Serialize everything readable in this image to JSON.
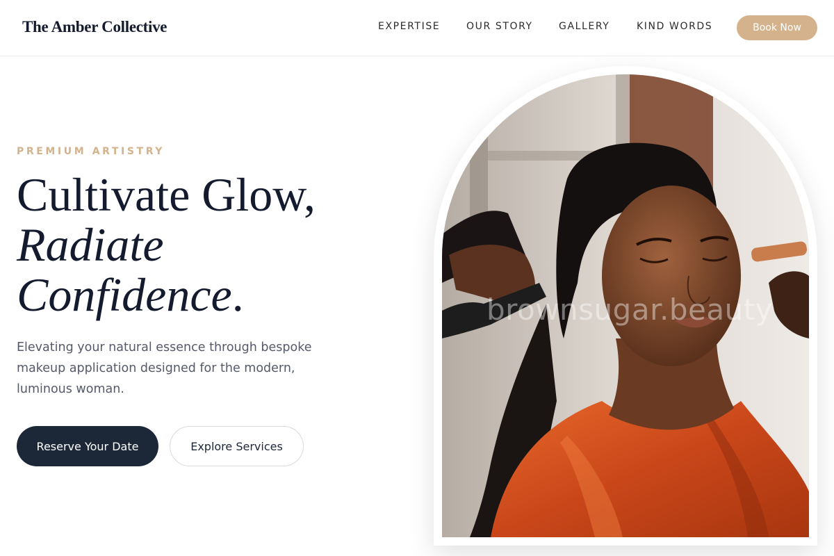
{
  "header": {
    "brand": "The Amber Collective",
    "nav": [
      "EXPERTISE",
      "OUR STORY",
      "GALLERY",
      "KIND WORDS"
    ],
    "cta": "Book Now"
  },
  "hero": {
    "eyebrow": "PREMIUM ARTISTRY",
    "headline_line1": "Cultivate Glow,",
    "headline_line2": "Radiate",
    "headline_line3_italic": "Confidence",
    "headline_line3_end": ".",
    "subtext": "Elevating your natural essence through bespoke makeup application designed for the modern, luminous woman.",
    "primary_button": "Reserve Your Date",
    "secondary_button": "Explore Services",
    "image_watermark": "brownsugar.beauty"
  },
  "colors": {
    "accent": "#d4b28c",
    "navy": "#1c2738",
    "text_dark": "#141b2e",
    "text_muted": "#55596a",
    "robe_orange": "#d2521c"
  }
}
